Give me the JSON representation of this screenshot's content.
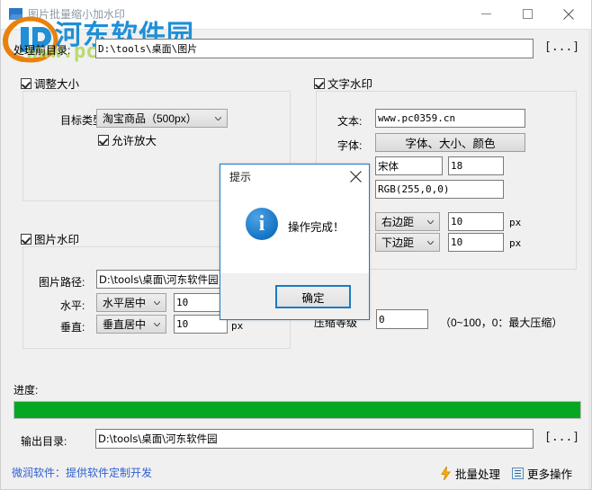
{
  "window": {
    "title": "图片批量缩小加水印",
    "minimize_label": "最小化",
    "maximize_label": "最大化",
    "close_label": "关闭"
  },
  "watermark": {
    "site_name": "河东软件园",
    "url": "www.pc0359.cn"
  },
  "source": {
    "label": "处理前目录:",
    "value": "D:\\tools\\桌面\\图片",
    "browse_label": "[...]"
  },
  "resize": {
    "checkbox_label": "调整大小",
    "target_type_label": "目标类型:",
    "target_type_value": "淘宝商品（500px）",
    "allow_enlarge_label": "允许放大"
  },
  "image_watermark": {
    "checkbox_label": "图片水印",
    "path_label": "图片路径:",
    "path_value": "D:\\tools\\桌面\\河东软件园",
    "horizontal_label": "水平:",
    "horizontal_value": "水平居中",
    "horizontal_offset": "10",
    "vertical_label": "垂直:",
    "vertical_value": "垂直居中",
    "vertical_offset": "10",
    "unit": "px"
  },
  "text_watermark": {
    "checkbox_label": "文字水印",
    "text_label": "文本:",
    "text_value": "www.pc0359.cn",
    "font_label": "字体:",
    "font_button_label": "字体、大小、颜色",
    "font_family_value": "宋体",
    "font_size_value": "18",
    "font_color_value": "RGB(255,0,0)",
    "right_margin_mode": "右边距",
    "right_margin_value": "10",
    "bottom_margin_mode": "下边距",
    "bottom_margin_value": "10",
    "unit": "px"
  },
  "compression": {
    "label": "压缩等级",
    "value": "0",
    "hint": "（0~100，0：最大压缩）"
  },
  "progress": {
    "label": "进度:",
    "percent": 100
  },
  "output": {
    "label": "输出目录:",
    "value": "D:\\tools\\桌面\\河东软件园",
    "browse_label": "[...]"
  },
  "footer": {
    "link_text": "微润软件：提供软件定制开发",
    "batch_action": "批量处理",
    "more_action": "更多操作"
  },
  "dialog": {
    "title": "提示",
    "message": "操作完成！",
    "ok_label": "确定",
    "close_label": "关闭"
  }
}
